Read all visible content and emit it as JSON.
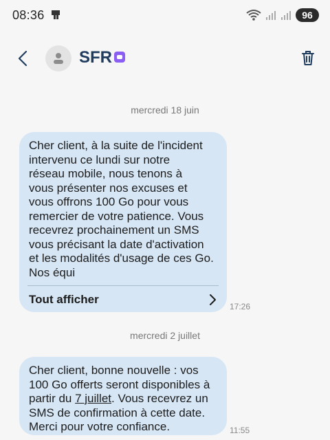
{
  "status_bar": {
    "time": "08:36",
    "battery": "96",
    "icons": [
      "notification-icon",
      "wifi-icon",
      "signal-icon",
      "signal-icon-2"
    ]
  },
  "header": {
    "contact_name": "SFR",
    "icons": [
      "back-icon",
      "avatar-icon",
      "trash-icon",
      "badge-icon"
    ]
  },
  "conversation": {
    "date1": "mercredi 18 juin",
    "message1": {
      "text": "Cher client, à la suite de l'incident\nintervenu ce lundi sur notre\nréseau mobile, nous tenons à\nvous présenter nos excuses et\nvous offrons 100 Go pour vous\nremercier de votre patience. Vous\nrecevrez prochainement un SMS\nvous précisant la date d'activation\net les modalités d'usage de ces Go.\nNos équi",
      "show_all": "Tout afficher",
      "time": "17:26"
    },
    "date2": "mercredi 2 juillet",
    "message2": {
      "text_before": "Cher client, bonne nouvelle : vos\n100 Go offerts seront disponibles à\npartir du ",
      "link": "7 juillet",
      "text_after": ". Vous recevrez un\nSMS de confirmation à cette date.\nMerci pour votre confiance.",
      "time": "11:55"
    }
  },
  "colors": {
    "bubble": "#d6e6f5",
    "contact": "#1f3c5f",
    "background": "#f6f6f6"
  }
}
